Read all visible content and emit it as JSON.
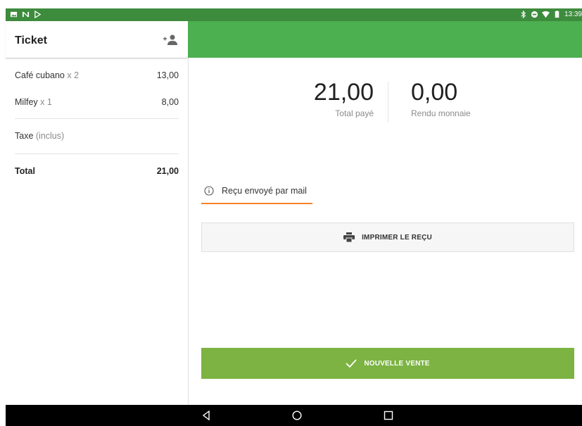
{
  "status_bar": {
    "time": "13:39",
    "left_icons": [
      "image-icon",
      "n-icon",
      "play-store-icon"
    ],
    "right_icons": [
      "bluetooth-icon",
      "do-not-disturb-icon",
      "wifi-icon",
      "battery-icon"
    ]
  },
  "ticket": {
    "title": "Ticket",
    "items": [
      {
        "name": "Café cubano",
        "qty": "x 2",
        "amount": "13,00"
      },
      {
        "name": "Milfey",
        "qty": "x 1",
        "amount": "8,00"
      }
    ],
    "tax_label": "Taxe",
    "tax_note": "(inclus)",
    "total_label": "Total",
    "total_amount": "21,00"
  },
  "payment": {
    "total_paid_value": "21,00",
    "total_paid_label": "Total payé",
    "change_value": "0,00",
    "change_label": "Rendu monnaie"
  },
  "receipt_mail_label": "Reçu envoyé par mail",
  "print_button_label": "IMPRIMER LE REÇU",
  "new_sale_button_label": "NOUVELLE VENTE",
  "colors": {
    "status_bar": "#3d8b3d",
    "header_green": "#4caf50",
    "new_sale_green": "#7cb342",
    "accent_orange": "#f5822a"
  }
}
